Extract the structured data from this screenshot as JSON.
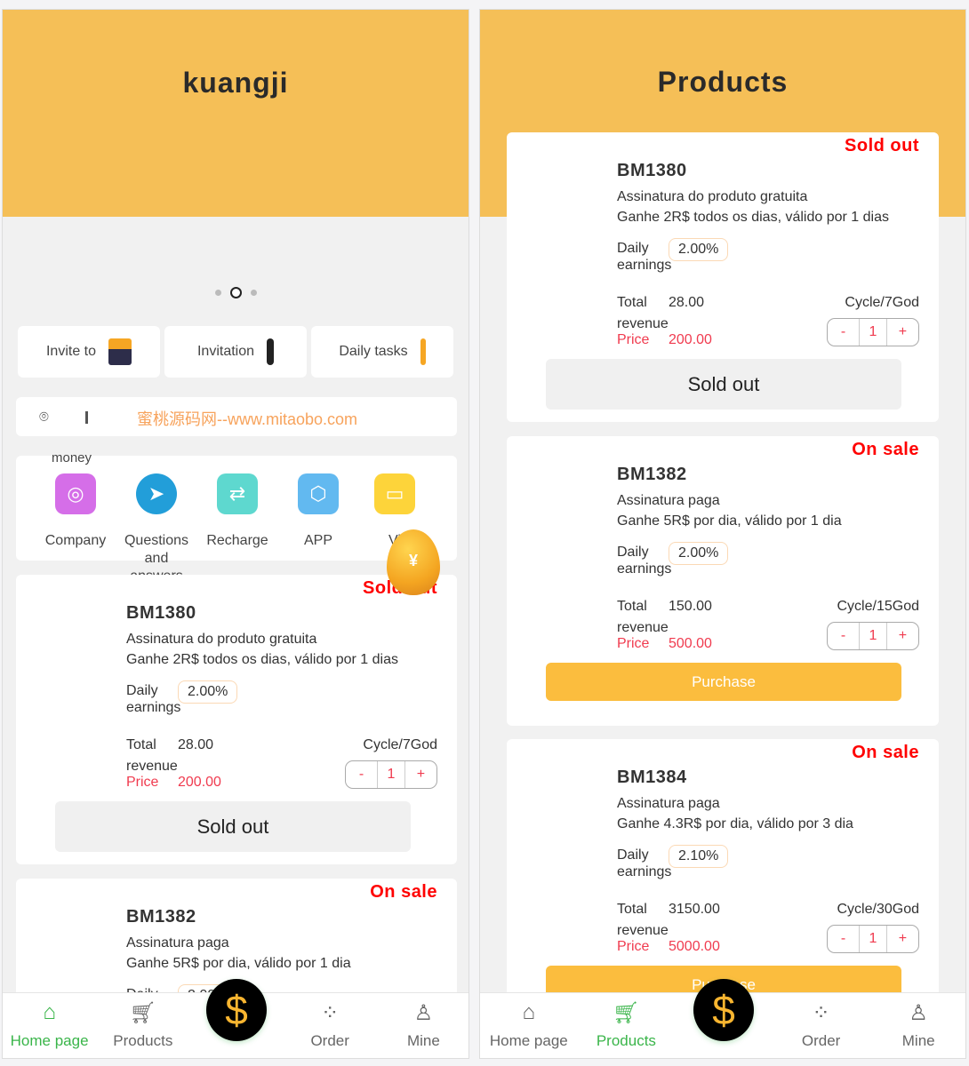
{
  "home": {
    "title": "kuangji",
    "quick_buttons": [
      {
        "label": "Invite to",
        "icon": "gift-icon"
      },
      {
        "label": "Invitation",
        "icon": "person-icon"
      },
      {
        "label": "Daily tasks",
        "icon": "task-icon"
      }
    ],
    "notice": {
      "icon": "broadcast-icon",
      "text": "蜜桃源码网--www.mitaobo.com"
    },
    "overflow_label": "money",
    "grid": [
      {
        "label": "Company",
        "icon": "globe-icon",
        "color": "#d56ee8"
      },
      {
        "label": "Questions and answers",
        "icon": "telegram-icon",
        "color": "#229ed9"
      },
      {
        "label": "Recharge",
        "icon": "wallet-icon",
        "color": "#5ed8cf"
      },
      {
        "label": "APP",
        "icon": "cube-icon",
        "color": "#62b9f0"
      },
      {
        "label": "Vi",
        "icon": "video-icon",
        "color": "#fdd43a"
      }
    ],
    "egg_text": "¥"
  },
  "products_page": {
    "title": "Products"
  },
  "labels": {
    "daily": "Daily earnings",
    "total": "Total",
    "revenue": "revenue",
    "price": "Price",
    "minus": "-",
    "plus": "+"
  },
  "products": [
    {
      "name": "BM1380",
      "status": "Sold out",
      "sub1": "Assinatura do produto gratuita",
      "sub2": "Ganhe 2R$ todos os dias, válido por 1 dias",
      "daily": "2.00%",
      "total": "28.00",
      "cycle": "Cycle/7God",
      "price": "200.00",
      "qty": "1",
      "action": "Sold out",
      "sold": true
    },
    {
      "name": "BM1382",
      "status": "On sale",
      "sub1": "Assinatura paga",
      "sub2": "Ganhe 5R$ por dia, válido por 1 dia",
      "daily": "2.00%",
      "total": "150.00",
      "cycle": "Cycle/15God",
      "price": "500.00",
      "qty": "1",
      "action": "Purchase",
      "sold": false
    },
    {
      "name": "BM1384",
      "status": "On sale",
      "sub1": "Assinatura paga",
      "sub2": "Ganhe 4.3R$ por dia, válido por 3 dia",
      "daily": "2.10%",
      "total": "3150.00",
      "cycle": "Cycle/30God",
      "price": "5000.00",
      "qty": "1",
      "action": "Purchase",
      "sold": false
    }
  ],
  "nav": [
    {
      "label": "Home page",
      "icon": "home-icon"
    },
    {
      "label": "Products",
      "icon": "cart-icon"
    },
    {
      "label": "",
      "icon": "dollar-icon",
      "glyph": "$"
    },
    {
      "label": "Order",
      "icon": "grid-icon"
    },
    {
      "label": "Mine",
      "icon": "user-icon"
    }
  ],
  "colors": {
    "header": "#f5bf57",
    "accent": "#3ab54a",
    "sale": "#ff0000",
    "price": "#f03b4f",
    "button": "#fbbd3e"
  }
}
